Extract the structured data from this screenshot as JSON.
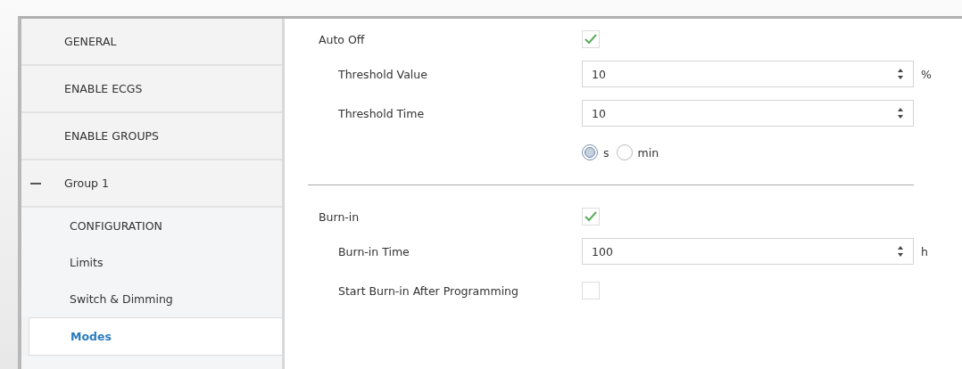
{
  "sidebar": {
    "items": [
      {
        "label": "GENERAL",
        "selected": false
      },
      {
        "label": "ENABLE ECGS",
        "selected": false
      },
      {
        "label": "ENABLE GROUPS",
        "selected": false
      },
      {
        "label": "Group 1",
        "expanded": true,
        "selected": false,
        "children": [
          {
            "label": "CONFIGURATION",
            "selected": false
          },
          {
            "label": "Limits",
            "selected": false
          },
          {
            "label": "Switch & Dimming",
            "selected": false
          },
          {
            "label": "Modes",
            "selected": true
          }
        ]
      }
    ]
  },
  "sections": [
    {
      "rows": [
        {
          "kind": "checkbox",
          "label": "Auto Off",
          "checked": true,
          "indent": false
        },
        {
          "kind": "spin",
          "label": "Threshold Value",
          "value": "10",
          "unit": "%"
        },
        {
          "kind": "spin",
          "label": "Threshold Time",
          "value": "10"
        },
        {
          "kind": "radio",
          "options": [
            {
              "label": "s",
              "selected": true
            },
            {
              "label": "min",
              "selected": false
            }
          ]
        }
      ]
    },
    {
      "rows": [
        {
          "kind": "checkbox",
          "label": "Burn-in",
          "checked": true,
          "indent": false
        },
        {
          "kind": "spin",
          "label": "Burn-in Time",
          "value": "100",
          "unit": "h"
        },
        {
          "kind": "checkbox",
          "label": "Start Burn-in After Programming",
          "checked": false,
          "indent": true
        }
      ]
    }
  ]
}
